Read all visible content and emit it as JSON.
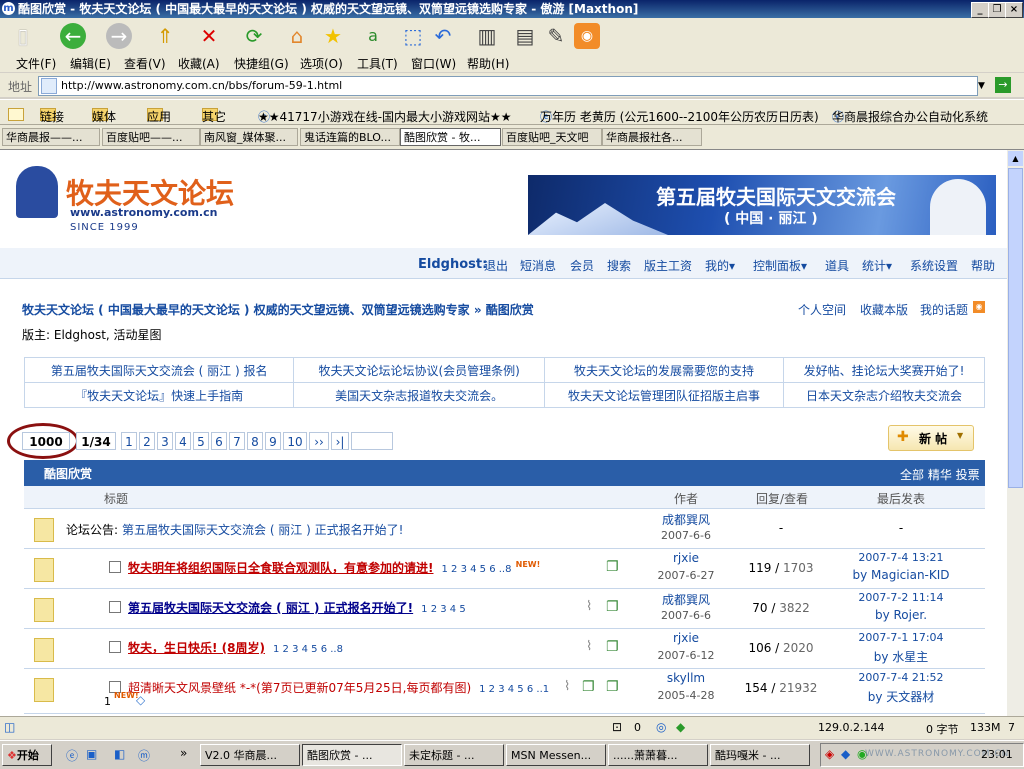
{
  "window": {
    "title": "酷图欣赏 - 牧夫天文论坛 ( 中国最大最早的天文论坛 ) 权威的天文望远镜、双筒望远镜选购专家 - 傲游 [Maxthon]"
  },
  "menu": [
    "文件(F)",
    "编辑(E)",
    "查看(V)",
    "收藏(A)",
    "快捷组(G)",
    "选项(O)",
    "工具(T)",
    "窗口(W)",
    "帮助(H)"
  ],
  "address": {
    "label": "地址",
    "url": "http://www.astronomy.com.cn/bbs/forum-59-1.html"
  },
  "favorites": [
    "链接",
    "媒体",
    "应用",
    "其它",
    "★★41717小游戏在线-国内最大小游戏网站★★",
    "万年历 老黄历 (公元1600--2100年公历农历日历表)",
    "华商晨报综合办公自动化系统"
  ],
  "tabs": [
    "华商晨报——...",
    "百度贴吧——...",
    "南风窗_媒体聚...",
    "鬼话连篇的BLO...",
    "酷图欣赏 - 牧...",
    "百度贴吧_天文吧",
    "华商晨报社各..."
  ],
  "forum": {
    "logo_text": "牧夫天文论坛",
    "logo_url": "www.astronomy.com.cn",
    "logo_since": "SINCE 1999",
    "banner_title": "第五届牧夫国际天文交流会",
    "banner_sub": "( 中国 · 丽江 )",
    "user": "Eldghost:",
    "nav": [
      "退出",
      "短消息",
      "会员",
      "搜索",
      "版主工资",
      "我的▾",
      "控制面板▾",
      "道具",
      "统计▾",
      "系统设置",
      "帮助"
    ],
    "breadcrumb": "牧夫天文论坛 ( 中国最大最早的天文论坛 ) 权威的天文望远镜、双筒望远镜选购专家 » 酷图欣赏",
    "right_links": [
      "个人空间",
      "收藏本版",
      "我的话题"
    ],
    "moderators": "版主: Eldghost, 活动星图",
    "announcements": [
      [
        "第五届牧夫国际天文交流会 ( 丽江 ) 报名",
        "牧夫天文论坛论坛协议(会员管理条例)",
        "牧夫天文论坛的发展需要您的支持",
        "发好帖、挂论坛大奖赛开始了!"
      ],
      [
        "『牧夫天文论坛』快速上手指南",
        "美国天文杂志报道牧夫交流会。",
        "牧夫天文论坛管理团队征招版主启事",
        "日本天文杂志介绍牧夫交流会"
      ]
    ],
    "pagination": {
      "count": "1000",
      "pages": "1/34",
      "numbers": [
        "1",
        "2",
        "3",
        "4",
        "5",
        "6",
        "7",
        "8",
        "9",
        "10"
      ],
      "next": "››",
      "last": "›|"
    },
    "new_post": "新 帖",
    "section_title": "酷图欣赏",
    "section_links": "全部 精华 投票",
    "columns": {
      "title": "标题",
      "author": "作者",
      "replies": "回复/查看",
      "last": "最后发表"
    },
    "notice": {
      "prefix": "论坛公告:",
      "text": "第五届牧夫国际天文交流会 ( 丽江 ) 正式报名开始了!",
      "author": "成都巽风",
      "date": "2007-6-6",
      "replies": "-",
      "last": "-"
    },
    "threads": [
      {
        "title": "牧夫明年将组织国际日全食联合观测队，有意参加的请进!",
        "color": "#c00000",
        "pages": "1 2 3 4 5 6 ..8",
        "author": "rjxie",
        "date": "2007-6-27",
        "replies": "119",
        "views": "1703",
        "last_time": "2007-7-4 13:21",
        "last_by": "by Magician-KID"
      },
      {
        "title": "第五届牧夫国际天文交流会 ( 丽江 ) 正式报名开始了!",
        "color": "#00008b",
        "pages": "1 2 3 4 5",
        "author": "成都巽风",
        "date": "2007-6-6",
        "replies": "70",
        "views": "3822",
        "last_time": "2007-7-2 11:14",
        "last_by": "by Rojer."
      },
      {
        "title": "牧夫，生日快乐! (8周岁)",
        "color": "#c00000",
        "pages": "1 2 3 4 5 6 ..8",
        "author": "rjxie",
        "date": "2007-6-12",
        "replies": "106",
        "views": "2020",
        "last_time": "2007-7-1 17:04",
        "last_by": "by 水星主"
      },
      {
        "title": "超清晰天文风景壁纸 *-*(第7页已更新07年5月25日,每页都有图)",
        "color": "#c00000",
        "pages": "1 2 3 4 5 6 ..1",
        "author": "skyllm",
        "date": "2005-4-28",
        "replies": "154",
        "views": "21932",
        "last_time": "2007-7-4 21:52",
        "last_by": "by 天文器材"
      }
    ]
  },
  "status": {
    "zero": "0",
    "ip": "129.0.2.144",
    "bytes": "0 字节",
    "mem": "133M",
    "num": "7"
  },
  "taskbar": {
    "start": "开始",
    "items": [
      "V2.0 华商晨...",
      "酷图欣赏 - ...",
      "未定标题 - ...",
      "MSN Messen...",
      "......萧萧暮...",
      "酷玛嘎米 - ..."
    ],
    "watermark": "WWW.ASTRONOMY.COM.CN",
    "clock": "23:01"
  }
}
